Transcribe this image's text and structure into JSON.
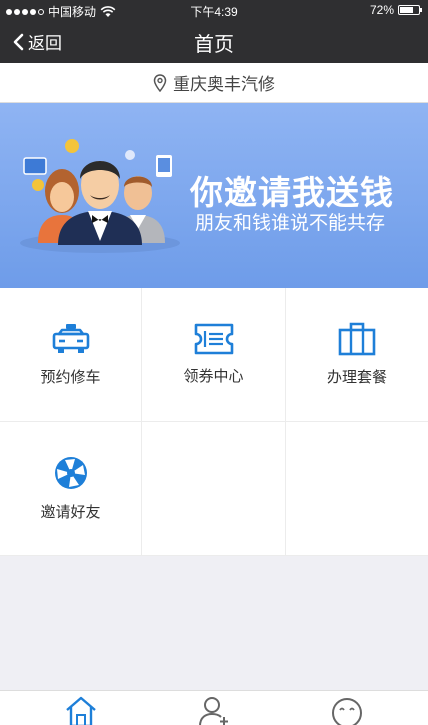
{
  "status_bar": {
    "carrier": "中国移动",
    "time": "下午4:39",
    "battery": "72%",
    "battery_level": 0.72
  },
  "nav": {
    "back_label": "返回",
    "title": "首页"
  },
  "location": {
    "name": "重庆奥丰汽修"
  },
  "banner": {
    "headline": "你邀请我送钱",
    "subline": "朋友和钱谁说不能共存"
  },
  "grid": {
    "items": [
      {
        "label": "预约修车",
        "icon": "car-icon"
      },
      {
        "label": "领券中心",
        "icon": "ticket-icon"
      },
      {
        "label": "办理套餐",
        "icon": "package-icon"
      },
      {
        "label": "邀请好友",
        "icon": "invite-icon"
      }
    ]
  },
  "tabbar": {
    "icons": [
      "home-icon",
      "user-add-icon",
      "smile-icon"
    ]
  },
  "colors": {
    "accent": "#1e7fd8",
    "nav_bg": "#2f2f31",
    "banner": "#7ea8ee"
  }
}
